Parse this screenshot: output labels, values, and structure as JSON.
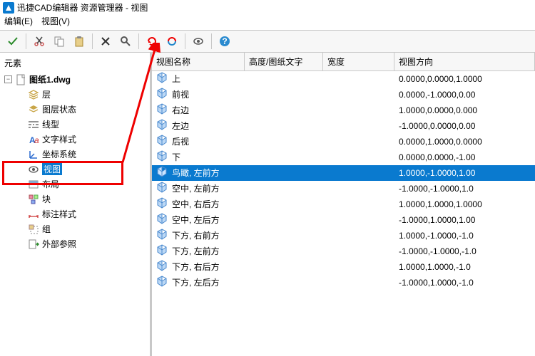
{
  "window": {
    "title": "迅捷CAD编辑器 资源管理器 - 视图"
  },
  "menu": {
    "edit": "编辑(E)",
    "view": "视图(V)"
  },
  "sidebar": {
    "title": "元素",
    "root": "图纸1.dwg",
    "items": [
      {
        "label": "层",
        "icon": "layers"
      },
      {
        "label": "图层状态",
        "icon": "layerstate"
      },
      {
        "label": "线型",
        "icon": "linetype"
      },
      {
        "label": "文字样式",
        "icon": "textstyle"
      },
      {
        "label": "坐标系统",
        "icon": "ucs"
      },
      {
        "label": "视图",
        "icon": "view"
      },
      {
        "label": "布局",
        "icon": "layout"
      },
      {
        "label": "块",
        "icon": "block"
      },
      {
        "label": "标注样式",
        "icon": "dimstyle"
      },
      {
        "label": "组",
        "icon": "group"
      },
      {
        "label": "外部参照",
        "icon": "xref"
      }
    ],
    "selectedIndex": 5
  },
  "grid": {
    "columns": {
      "name": "视图名称",
      "height": "高度/图纸文字",
      "width": "宽度",
      "direction": "视图方向"
    },
    "rows": [
      {
        "name": "上",
        "dir": "0.0000,0.0000,1.0000"
      },
      {
        "name": "前视",
        "dir": "0.0000,-1.0000,0.00"
      },
      {
        "name": "右边",
        "dir": "1.0000,0.0000,0.000"
      },
      {
        "name": "左边",
        "dir": "-1.0000,0.0000,0.00"
      },
      {
        "name": "后视",
        "dir": "0.0000,1.0000,0.0000"
      },
      {
        "name": "下",
        "dir": "0.0000,0.0000,-1.00"
      },
      {
        "name": "鸟瞰, 左前方",
        "dir": "1.0000,-1.0000,1.00"
      },
      {
        "name": "空中, 左前方",
        "dir": "-1.0000,-1.0000,1.0"
      },
      {
        "name": "空中, 右后方",
        "dir": "1.0000,1.0000,1.0000"
      },
      {
        "name": "空中, 左后方",
        "dir": "-1.0000,1.0000,1.00"
      },
      {
        "name": "下方, 右前方",
        "dir": "1.0000,-1.0000,-1.0"
      },
      {
        "name": "下方, 左前方",
        "dir": "-1.0000,-1.0000,-1.0"
      },
      {
        "name": "下方, 右后方",
        "dir": "1.0000,1.0000,-1.0"
      },
      {
        "name": "下方, 左后方",
        "dir": "-1.0000,1.0000,-1.0"
      }
    ],
    "selectedIndex": 6
  },
  "colors": {
    "accent": "#0a7acf",
    "highlight": "#e00"
  }
}
